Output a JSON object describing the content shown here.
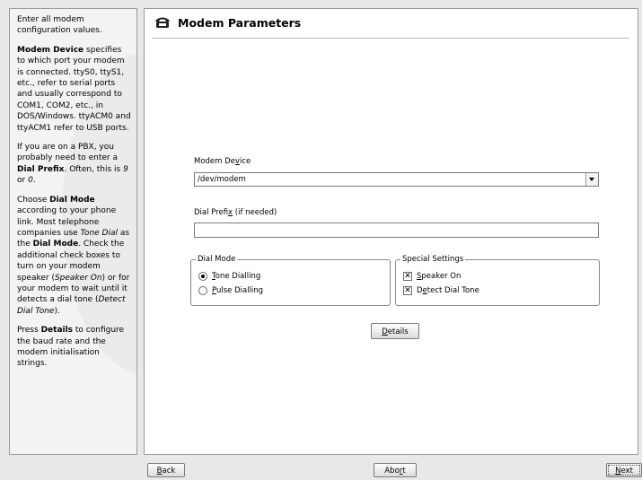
{
  "help": {
    "p1": "Enter all modem configuration values.",
    "p2_bold": "Modem Device",
    "p2_rest": " specifies to which port your modem is connected. ttyS0, ttyS1, etc., refer to serial ports and usually correspond to COM1, COM2, etc., in DOS/Windows. ttyACM0 and ttyACM1 refer to USB ports.",
    "p3_a": "If you are on a PBX, you probably need to enter a ",
    "p3_bold": "Dial Prefix",
    "p3_b": ". Often, this is ",
    "p3_i1": "9",
    "p3_c": " or ",
    "p3_i2": "0",
    "p3_d": ".",
    "p4_a": "Choose ",
    "p4_b1": "Dial Mode",
    "p4_b": " according to your phone link. Most telephone companies use ",
    "p4_i1": "Tone Dial",
    "p4_c": " as the ",
    "p4_b2": "Dial Mode",
    "p4_d": ". Check the additional check boxes to turn on your modem speaker (",
    "p4_i2": "Speaker On",
    "p4_e": ") or for your modem to wait until it detects a dial tone (",
    "p4_i3": "Detect Dial Tone",
    "p4_f": ").",
    "p5_a": "Press ",
    "p5_bold": "Details",
    "p5_b": " to configure the baud rate and the modem initialisation strings."
  },
  "main": {
    "title": "Modem Parameters",
    "title_icon": "modem-icon",
    "modem_device": {
      "label_a": "Modem De",
      "label_u": "v",
      "label_b": "ice",
      "value": "/dev/modem"
    },
    "dial_prefix": {
      "label_a": "Dial Prefi",
      "label_u": "x",
      "label_b": " (if needed)",
      "value": ""
    },
    "dial_mode": {
      "title": "Dial Mode",
      "tone": {
        "u": "T",
        "rest": "one Dialling",
        "selected": true
      },
      "pulse": {
        "u": "P",
        "rest": "ulse Dialling",
        "selected": false
      }
    },
    "special": {
      "title": "Special Settings",
      "speaker": {
        "u": "S",
        "rest": "peaker On",
        "checked": true
      },
      "detect": {
        "a": "D",
        "u": "e",
        "rest": "tect Dial Tone",
        "checked": true
      }
    },
    "details": {
      "u": "D",
      "rest": "etails"
    }
  },
  "footer": {
    "back": {
      "u": "B",
      "rest": "ack"
    },
    "abort": {
      "a": "Abo",
      "u": "r",
      "rest": "t"
    },
    "next": {
      "u": "N",
      "rest": "ext"
    }
  }
}
